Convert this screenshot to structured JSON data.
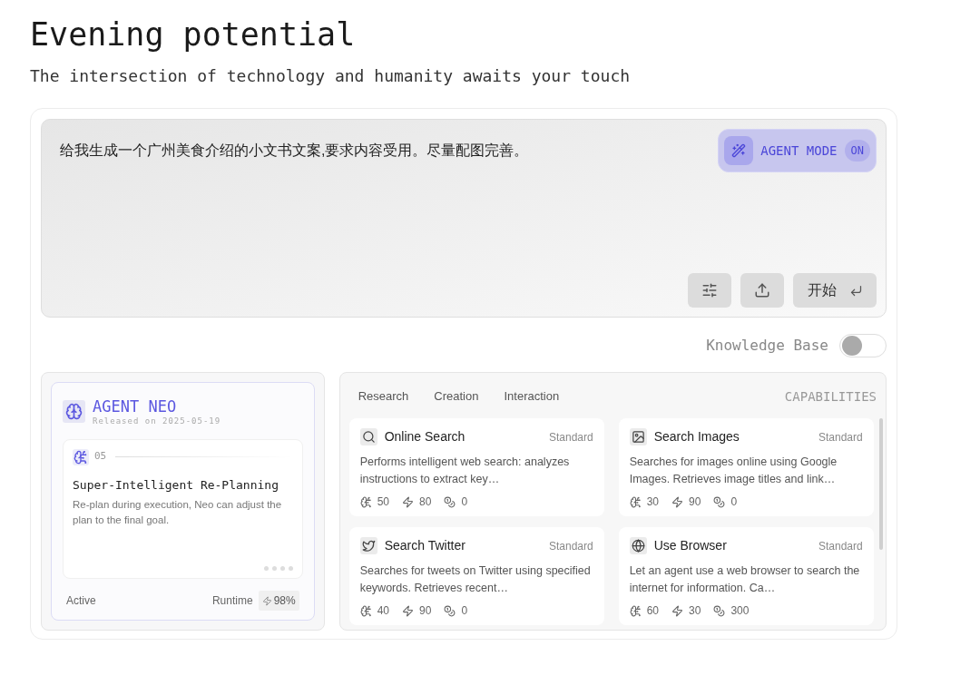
{
  "title": "Evening potential",
  "subtitle": "The intersection of technology and humanity awaits your touch",
  "prompt": {
    "value": "给我生成一个广州美食介绍的小文书文案,要求内容受用。尽量配图完善。",
    "agent_mode": {
      "label": "AGENT MODE",
      "state": "ON",
      "on": true
    },
    "start_button": "开始"
  },
  "knowledge_base": {
    "label": "Knowledge Base",
    "on": false
  },
  "agent": {
    "name": "AGENT NEO",
    "released": "Released on 2025-05-19",
    "feature": {
      "number": "05",
      "title": "Super-Intelligent Re-Planning",
      "description": "Re-plan during execution, Neo can adjust the plan to the final goal."
    },
    "status": "Active",
    "runtime_label": "Runtime",
    "runtime": "98%"
  },
  "capabilities": {
    "tabs": [
      "Research",
      "Creation",
      "Interaction"
    ],
    "heading": "CAPABILITIES",
    "cards": [
      {
        "kind": "search",
        "name": "Online Search",
        "tier": "Standard",
        "description": "Performs intelligent web search: analyzes instructions to extract key…",
        "stats": [
          "50",
          "80",
          "0"
        ]
      },
      {
        "kind": "image",
        "name": "Search Images",
        "tier": "Standard",
        "description": "Searches for images online using Google Images. Retrieves image titles and link…",
        "stats": [
          "30",
          "90",
          "0"
        ]
      },
      {
        "kind": "twitter",
        "name": "Search Twitter",
        "tier": "Standard",
        "description": "Searches for tweets on Twitter using specified keywords. Retrieves recent…",
        "stats": [
          "40",
          "90",
          "0"
        ]
      },
      {
        "kind": "globe",
        "name": "Use Browser",
        "tier": "Standard",
        "description": "Let an agent use a web browser to search the internet for information. Ca…",
        "stats": [
          "60",
          "30",
          "300"
        ]
      }
    ]
  }
}
